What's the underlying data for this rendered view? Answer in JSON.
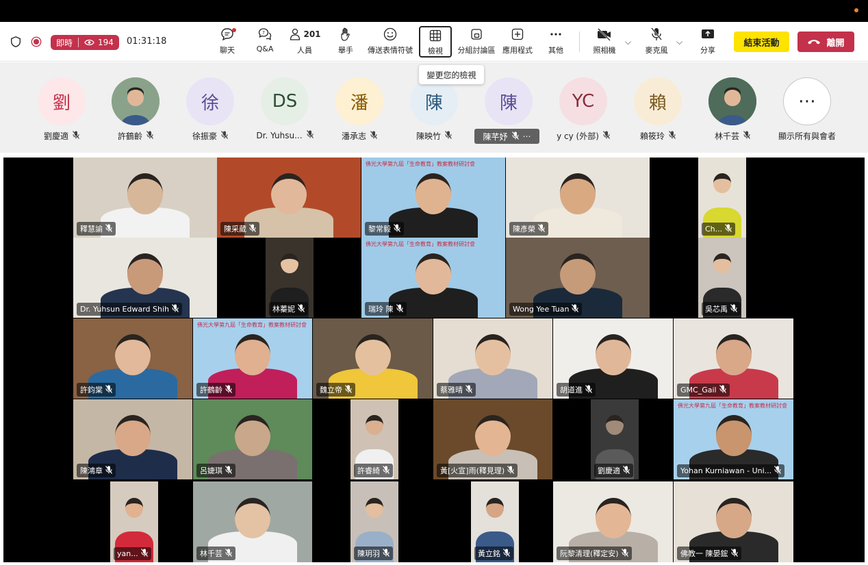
{
  "toolbar": {
    "live_label": "即時",
    "viewers": "194",
    "timer": "01:31:18",
    "buttons": {
      "chat": "聊天",
      "qa": "Q&A",
      "people": "人員",
      "people_count": "201",
      "raise": "舉手",
      "react": "傳送表情符號",
      "view": "檢視",
      "rooms": "分組討論區",
      "apps": "應用程式",
      "more": "其他",
      "camera": "照相機",
      "mic": "麥克風",
      "share": "分享"
    },
    "end_event": "結束活動",
    "leave": "離開",
    "tooltip": "變更您的檢視"
  },
  "strip": [
    {
      "initial": "劉",
      "name": "劉慶適",
      "color": "#fde7e9",
      "text": "#c4314b"
    },
    {
      "initial": "",
      "name": "許鶴齡",
      "color": "#8aa28a",
      "text": "#fff",
      "photo": true
    },
    {
      "initial": "徐",
      "name": "徐振豪",
      "color": "#e8e4f5",
      "text": "#5c4c94"
    },
    {
      "initial": "DS",
      "name": "Dr. Yuhsu...",
      "color": "#e5efe6",
      "text": "#2e4d35"
    },
    {
      "initial": "潘",
      "name": "潘承志",
      "color": "#fdf0d3",
      "text": "#8a5a00"
    },
    {
      "initial": "陳",
      "name": "陳映竹",
      "color": "#e6eef5",
      "text": "#2b5a80"
    },
    {
      "initial": "陳",
      "name": "陳芊妤",
      "color": "#e8e4f5",
      "text": "#5c4c94",
      "active": true
    },
    {
      "initial": "YC",
      "name": "y cy (外部)",
      "color": "#f5dfe2",
      "text": "#8a2e3c"
    },
    {
      "initial": "賴",
      "name": "賴筱玲",
      "color": "#f9ecd6",
      "text": "#7a5a20"
    },
    {
      "initial": "",
      "name": "林千芸",
      "color": "#4f6b5a",
      "text": "#fff",
      "photo": true
    },
    {
      "initial": "⋯",
      "name": "顯示所有與會者",
      "color": "#ffffff",
      "text": "#242424",
      "more": true
    }
  ],
  "tiles": [
    {
      "name": "釋慧諭",
      "bg": "#d8d0c4",
      "skin": "#d7b79a",
      "shirt": "#f2f2f2"
    },
    {
      "name": "陳采葳",
      "bg": "#b24a2a",
      "skin": "#e2b89a",
      "shirt": "#d6c2a8"
    },
    {
      "name": "黎常毅",
      "bg": "#9fcbe8",
      "skin": "#e0b390",
      "shirt": "#1f1f1f",
      "banner": "佛光大學第九屆「生命教育」教案教材研討會"
    },
    {
      "name": "陳彥榮",
      "bg": "#e8e4dc",
      "skin": "#d9a982",
      "shirt": "#efe8dc"
    },
    {
      "name": "Ch...",
      "bg": "#e7e2d8",
      "skin": "#e4bf9f",
      "shirt": "#d8d830"
    },
    {
      "name": "Dr. Yuhsun Edward Shih",
      "bg": "#e9e6df",
      "skin": "#c99a7a",
      "shirt": "#253550"
    },
    {
      "name": "林蓁妮",
      "bg": "#3a332c",
      "skin": "#e5c2a2",
      "shirt": "#1f1f1f"
    },
    {
      "name": "瑞玲 陳",
      "bg": "#9fcbe8",
      "skin": "#e2b89a",
      "shirt": "#1f1f1f",
      "banner": "佛光大學第九屆「生命教育」教案教材研討會"
    },
    {
      "name": "Wong Yee Tuan",
      "bg": "#6e5e4f",
      "skin": "#c69b7a",
      "shirt": "#1a2a3a"
    },
    {
      "name": "吳芯禹",
      "bg": "#cbc5bd",
      "skin": "#e3bf9f",
      "shirt": "#2a2a2a"
    },
    {
      "name": "許鈞棠",
      "bg": "#8a6244",
      "skin": "#e2b99a",
      "shirt": "#2a6aa0"
    },
    {
      "name": "許鶴齡",
      "bg": "#a7d0ec",
      "skin": "#e0b090",
      "shirt": "#c01f5a",
      "banner": "佛光大學第九屆「生命教育」教案教材研討會"
    },
    {
      "name": "魏立帝",
      "bg": "#6b5a48",
      "skin": "#e5c09e",
      "shirt": "#f0c63a"
    },
    {
      "name": "蔡雅晴",
      "bg": "#e5ddd2",
      "skin": "#e5c0a0",
      "shirt": "#a2a8b8"
    },
    {
      "name": "胡道進",
      "bg": "#f0eeea",
      "skin": "#e0b899",
      "shirt": "#1f1f1f"
    },
    {
      "name": "GMC_Gail",
      "bg": "#e9e4de",
      "skin": "#d8a888",
      "shirt": "#c83a4a"
    },
    {
      "name": "陳鴻章",
      "bg": "#c5b7a6",
      "skin": "#d8a888",
      "shirt": "#1e2d4a"
    },
    {
      "name": "呂婕琪",
      "bg": "#5f8a5a",
      "skin": "#c9a78a",
      "shirt": "#7a7070"
    },
    {
      "name": "許睿綺",
      "bg": "#cfc2b4",
      "skin": "#d9b090",
      "shirt": "#f0f0f0"
    },
    {
      "name": "黃[火宣]雨(釋見理)",
      "bg": "#6a4a2a",
      "skin": "#e3b593",
      "shirt": "#c8c0b6"
    },
    {
      "name": "劉慶適",
      "bg": "#3a3a3a",
      "skin": "#a08a78",
      "shirt": "#5a5a5a"
    },
    {
      "name": "Yohan Kurniawan - Uni...",
      "bg": "#a7d0ec",
      "skin": "#c8956e",
      "shirt": "#2a2a2a",
      "banner": "佛光大學第九屆「生命教育」教案教材研討會"
    },
    {
      "name": "yan...",
      "bg": "#d6cbbf",
      "skin": "#e0b290",
      "shirt": "#d22a3a"
    },
    {
      "name": "林千芸",
      "bg": "#a0a8a4",
      "skin": "#e4c2a4",
      "shirt": "#f0f0f0"
    },
    {
      "name": "陳玥羽",
      "bg": "#c8c0b8",
      "skin": "#e3bf9f",
      "shirt": "#9ab0c8"
    },
    {
      "name": "黃立銘",
      "bg": "#e4e0da",
      "skin": "#d5a585",
      "shirt": "#3a5a8a"
    },
    {
      "name": "阮黎清理(釋定安)",
      "bg": "#ece8e2",
      "skin": "#e3b796",
      "shirt": "#b8b0a6"
    },
    {
      "name": "佛教一 陳晏鋐",
      "bg": "#e6e0d6",
      "skin": "#d6a888",
      "shirt": "#2a2a2a"
    }
  ]
}
